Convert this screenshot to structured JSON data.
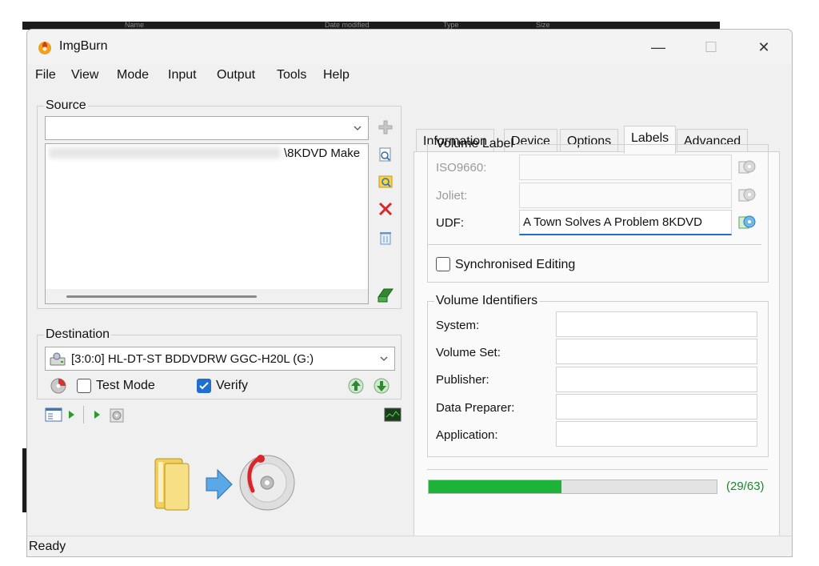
{
  "background": {
    "columns": [
      "Name",
      "Date modified",
      "Type",
      "Size"
    ]
  },
  "window": {
    "title": "ImgBurn",
    "controls": {
      "minimize": "—",
      "maximize": "☐",
      "close": "✕"
    }
  },
  "menu": [
    "File",
    "View",
    "Mode",
    "Input",
    "Output",
    "Tools",
    "Help"
  ],
  "source": {
    "legend": "Source",
    "combo_value": "",
    "file_entry": "\\8KDVD Make"
  },
  "destination": {
    "legend": "Destination",
    "drive": "[3:0:0] HL-DT-ST BDDVDRW GGC-H20L (G:)",
    "test_mode_label": "Test Mode",
    "test_mode_checked": false,
    "verify_label": "Verify",
    "verify_checked": true
  },
  "tabs": [
    "Information",
    "Device",
    "Options",
    "Labels",
    "Advanced"
  ],
  "active_tab": "Labels",
  "volume_label": {
    "legend": "Volume Label",
    "iso_label": "ISO9660:",
    "iso_value": "",
    "joliet_label": "Joliet:",
    "joliet_value": "",
    "udf_label": "UDF:",
    "udf_value": "A Town Solves A Problem 8KDVD",
    "sync_label": "Synchronised Editing",
    "sync_checked": false
  },
  "volume_identifiers": {
    "legend": "Volume Identifiers",
    "fields": [
      {
        "label": "System:",
        "value": ""
      },
      {
        "label": "Volume Set:",
        "value": ""
      },
      {
        "label": "Publisher:",
        "value": ""
      },
      {
        "label": "Data Preparer:",
        "value": ""
      },
      {
        "label": "Application:",
        "value": ""
      }
    ]
  },
  "progress": {
    "current": 29,
    "max": 63,
    "text": "(29/63)",
    "color": "#1db339"
  },
  "status": "Ready"
}
